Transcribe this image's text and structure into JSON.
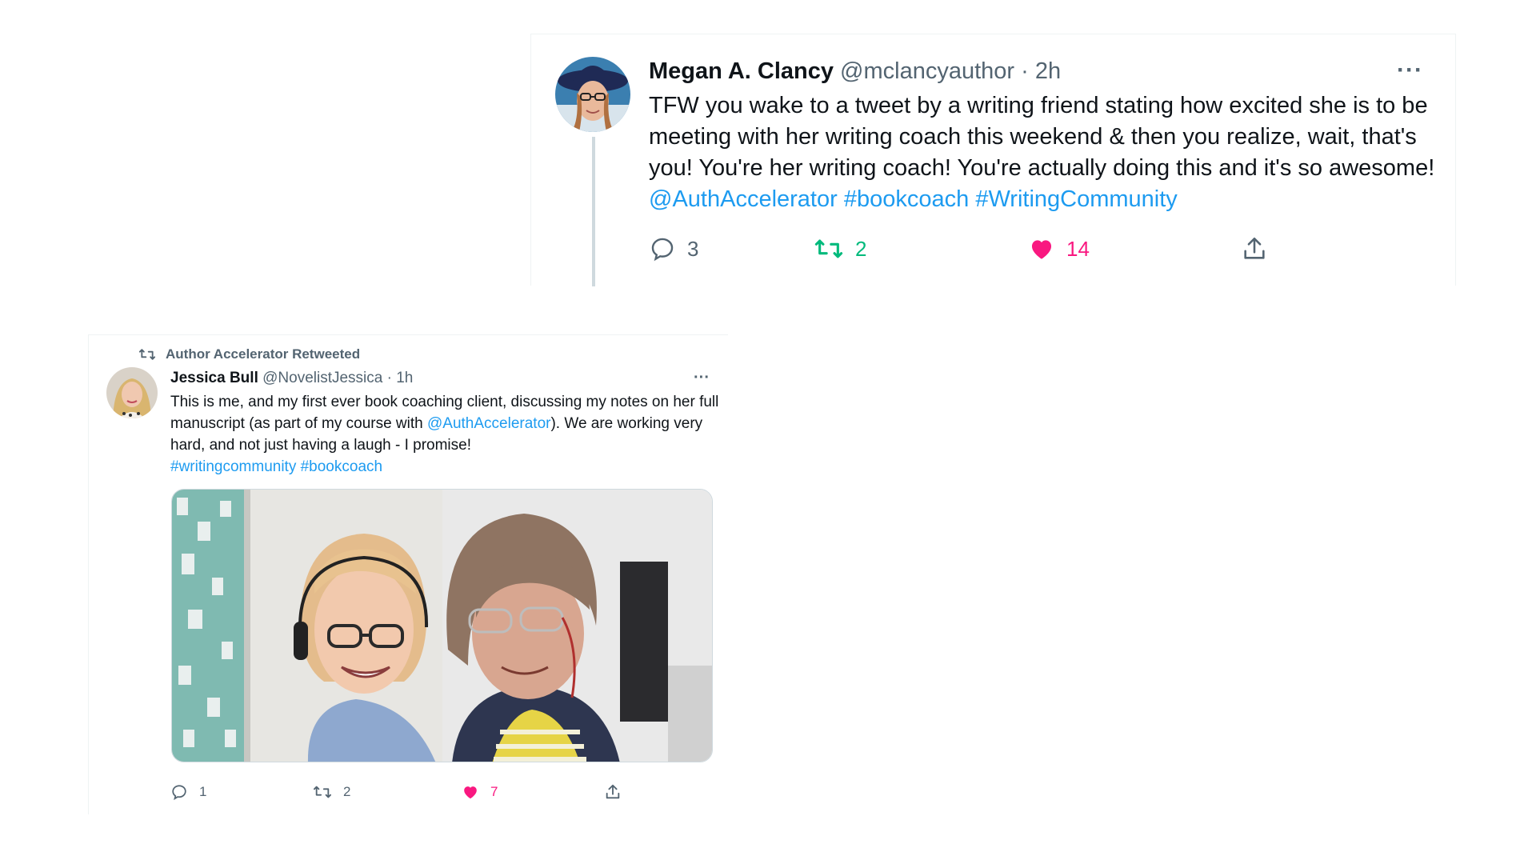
{
  "tweet1": {
    "name": "Megan A. Clancy",
    "handle": "@mclancyauthor",
    "separator": "·",
    "time": "2h",
    "more": "···",
    "text_plain": "TFW you wake to a tweet by a writing friend stating how excited she is to be meeting with her writing coach this weekend & then you realize, wait, that's you! You're her writing coach! You're actually doing this and it's so awesome! ",
    "mention": "@AuthAccelerator",
    "hashtag1": "#bookcoach",
    "hashtag2": "#WritingCommunity",
    "replies": "3",
    "retweets": "2",
    "likes": "14",
    "colors": {
      "retweet": "#00ba7c",
      "like": "#f91880",
      "link": "#1d9bf0",
      "muted": "#536471"
    }
  },
  "tweet2": {
    "retweeted_by": "Author Accelerator Retweeted",
    "name": "Jessica Bull",
    "handle": "@NovelistJessica",
    "separator": "·",
    "time": "1h",
    "more": "···",
    "text_part1": "This is me, and my first ever book coaching client, discussing my notes on her full manuscript (as part of my course with ",
    "mention": "@AuthAccelerator",
    "text_part2": "). We are working very hard, and not just having a laugh - I promise!",
    "hashtag1": "#writingcommunity",
    "hashtag2": "#bookcoach",
    "replies": "1",
    "retweets": "2",
    "likes": "7"
  },
  "icons": [
    "reply-icon",
    "retweet-icon",
    "like-icon",
    "share-icon",
    "more-icon",
    "retweeted-icon"
  ]
}
